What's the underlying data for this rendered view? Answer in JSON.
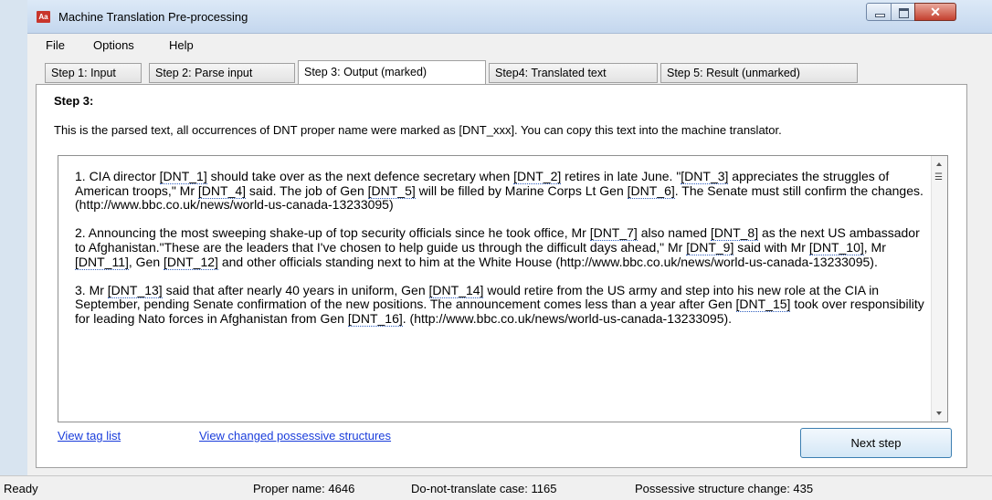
{
  "window": {
    "title": "Machine Translation Pre-processing",
    "icon_label": "Aa",
    "close_glyph": "✕"
  },
  "menu": [
    "File",
    "Options",
    "Help"
  ],
  "tabs": [
    {
      "label": "Step 1: Input"
    },
    {
      "label": "Step 2: Parse input"
    },
    {
      "label": "Step 3: Output (marked)",
      "active": true
    },
    {
      "label": "Step4: Translated text"
    },
    {
      "label": "Step 5: Result (unmarked)"
    }
  ],
  "step": {
    "title": "Step 3:",
    "description": "This is the parsed text, all occurrences of DNT proper name were marked as [DNT_xxx]. You can copy this text into the machine translator."
  },
  "output_paragraphs": [
    [
      "1. CIA director ",
      {
        "tag": "[DNT_1]"
      },
      " should take over as the next defence secretary when ",
      {
        "tag": "[DNT_2]"
      },
      " retires in late June. \"",
      {
        "tag": "[DNT_3]"
      },
      " appreciates the struggles of American troops,\" Mr ",
      {
        "tag": "[DNT_4]"
      },
      " said. The job of Gen ",
      {
        "tag": "[DNT_5]"
      },
      " will be filled by Marine Corps Lt Gen ",
      {
        "tag": "[DNT_6]"
      },
      ". The Senate must still confirm the changes. (http://www.bbc.co.uk/news/world-us-canada-13233095)"
    ],
    [
      "2. Announcing the most sweeping shake-up of top security officials since he took office, Mr ",
      {
        "tag": "[DNT_7]"
      },
      " also named ",
      {
        "tag": "[DNT_8]"
      },
      " as the next US ambassador to Afghanistan.\"These are the leaders that I've chosen to help guide us through the difficult days ahead,\" Mr ",
      {
        "tag": "[DNT_9]"
      },
      " said with Mr ",
      {
        "tag": "[DNT_10]"
      },
      ", Mr ",
      {
        "tag": "[DNT_11]"
      },
      ", Gen ",
      {
        "tag": "[DNT_12]"
      },
      " and other officials standing next to him at the White House (http://www.bbc.co.uk/news/world-us-canada-13233095)."
    ],
    [
      "3. Mr ",
      {
        "tag": "[DNT_13]"
      },
      " said that after nearly 40 years in uniform, Gen ",
      {
        "tag": "[DNT_14]"
      },
      " would retire from the US army and step into his new role at the CIA in September, pending Senate confirmation of the new positions. The announcement comes less than a year after Gen ",
      {
        "tag": "[DNT_15]"
      },
      " took over responsibility for leading Nato forces in Afghanistan from Gen ",
      {
        "tag": "[DNT_16]"
      },
      ". (http://www.bbc.co.uk/news/world-us-canada-13233095)."
    ]
  ],
  "links": {
    "view_tag_list": "View tag list",
    "view_possessive": "View changed possessive structures"
  },
  "next_button": "Next step",
  "status": {
    "ready": "Ready",
    "proper_name": "Proper name: 4646",
    "dnt_case": "Do-not-translate case: 1165",
    "possessive": "Possessive structure change: 435"
  }
}
